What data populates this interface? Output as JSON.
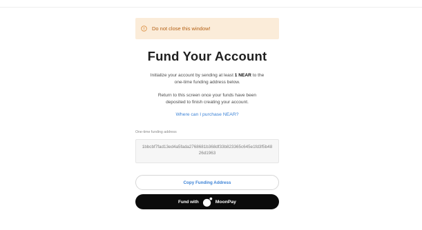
{
  "warning": {
    "text": "Do not close this window!",
    "icon": "info-circle-icon",
    "color": "#b45f12",
    "background": "#fbecd9"
  },
  "title": "Fund Your Account",
  "intro": {
    "before": "Initialize your account by sending at least ",
    "amount": "1 NEAR",
    "after": " to the one-time funding address below."
  },
  "return_note": "Return to this screen once your funds have been deposited to finish creating your account.",
  "purchase_link": "Where can I purchase NEAR?",
  "address": {
    "label": "One-time funding address",
    "value": "1bbcbf7fad13ed4a5fada2768681b368df33b823365c645e1fd3f5b4826d1963"
  },
  "buttons": {
    "copy": "Copy Funding Address",
    "fund_prefix": "Fund with",
    "fund_provider": "MoonPay"
  },
  "colors": {
    "link": "#3b82d6",
    "fund_button": "#0b0b0b"
  }
}
